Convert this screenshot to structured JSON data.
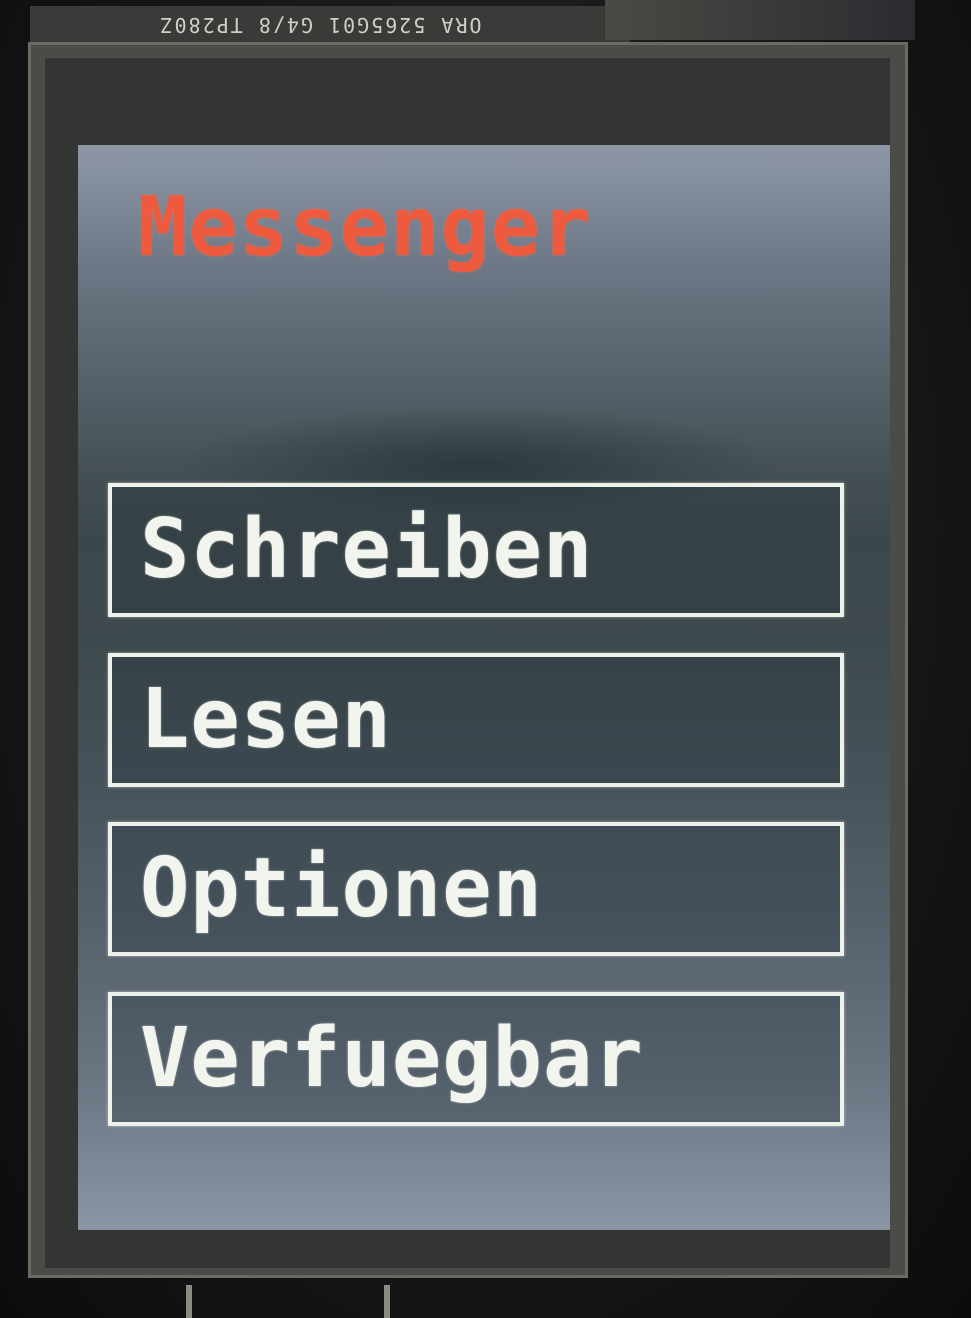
{
  "board": {
    "silkscreen": "ORA 5265G01   G4/8   TP280Z"
  },
  "screen": {
    "title": "Messenger",
    "title_color": "#ee5a3e",
    "menu": [
      {
        "label": "Schreiben"
      },
      {
        "label": "Lesen"
      },
      {
        "label": "Optionen"
      },
      {
        "label": "Verfuegbar"
      }
    ]
  }
}
